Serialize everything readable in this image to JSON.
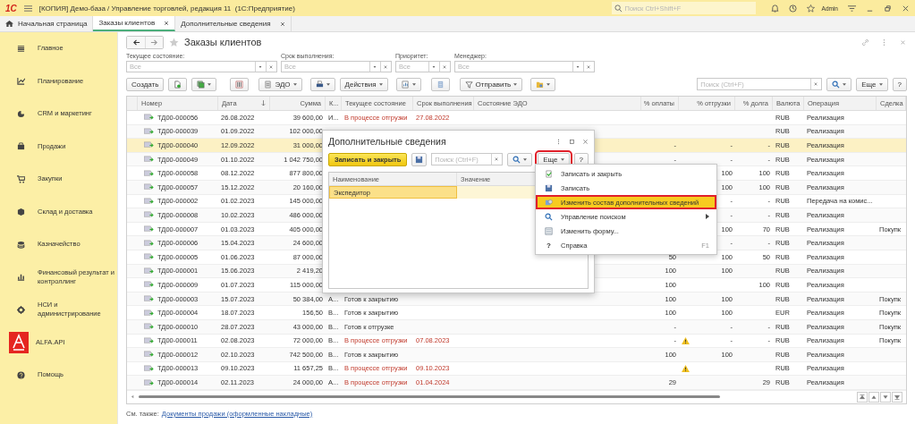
{
  "window": {
    "logo": "1С",
    "title": "[КОПИЯ] Демо-база / Управление торговлей, редакция 11  (1С:Предприятие)",
    "search_placeholder": "Поиск Ctrl+Shift+F",
    "user": "Admin"
  },
  "tabs": [
    {
      "label": "Начальная страница",
      "selected": false,
      "closable": false
    },
    {
      "label": "Заказы клиентов",
      "selected": true,
      "closable": true
    },
    {
      "label": "Дополнительные сведения",
      "selected": false,
      "closable": true
    }
  ],
  "sidebar": {
    "items": [
      {
        "label": "Главное",
        "kind": "list"
      },
      {
        "label": "Планирование",
        "kind": "chart"
      },
      {
        "label": "CRM и маркетинг",
        "kind": "pie"
      },
      {
        "label": "Продажи",
        "kind": "bag"
      },
      {
        "label": "Закупки",
        "kind": "cart"
      },
      {
        "label": "Склад и доставка",
        "kind": "box"
      },
      {
        "label": "Казначейство",
        "kind": "coins"
      },
      {
        "label": "Финансовый результат и контроллинг",
        "kind": "graph"
      },
      {
        "label": "НСИ и администрирование",
        "kind": "gear"
      },
      {
        "label": "ALFA.API",
        "kind": "logo"
      },
      {
        "label": "Помощь",
        "kind": "help"
      }
    ]
  },
  "form": {
    "title": "Заказы клиентов",
    "filters": [
      {
        "label": "Текущее состояние:",
        "placeholder": "Все"
      },
      {
        "label": "Срок выполнения:",
        "placeholder": "Все"
      },
      {
        "label": "Приоритет:",
        "placeholder": "Все"
      },
      {
        "label": "Менеджер:",
        "placeholder": "Все"
      }
    ]
  },
  "toolbar": {
    "items": [
      {
        "kind": "text",
        "label": "Создать",
        "dropdown": false
      },
      {
        "kind": "icon",
        "dropdown": false
      },
      {
        "kind": "icon",
        "dropdown": true
      },
      {
        "kind": "icon",
        "dropdown": false
      },
      {
        "kind": "text",
        "label": "ЭДО",
        "dropdown": true
      },
      {
        "kind": "icon",
        "dropdown": true
      },
      {
        "kind": "text",
        "label": "Действия",
        "dropdown": true
      },
      {
        "kind": "icon",
        "dropdown": true
      },
      {
        "kind": "icon",
        "dropdown": false
      },
      {
        "kind": "text",
        "label": "Отправить",
        "dropdown": true
      },
      {
        "kind": "icon",
        "dropdown": true
      }
    ],
    "search_placeholder": "Поиск (Ctrl+F)",
    "more": "Еще",
    "help": "?"
  },
  "table": {
    "columns": [
      "Номер",
      "Дата",
      "Сумма",
      "К...",
      "Текущее состояние",
      "Срок выполнения",
      "Состояние ЭДО",
      "% оплаты",
      "% отгрузки",
      "% долга",
      "Валюта",
      "Операция",
      "Сделка"
    ],
    "rows": [
      {
        "number": "ТД00-000056",
        "date": "26.08.2022",
        "sum": "39 600,00",
        "k": "И...",
        "state": "В процессе отгрузки",
        "overdue": true,
        "due": "27.08.2022",
        "currency": "RUB",
        "operation": "Реализация",
        "selected": false,
        "ship_warning": false
      },
      {
        "number": "ТД00-000039",
        "date": "01.09.2022",
        "sum": "102 000,00",
        "currency": "RUB",
        "operation": "Реализация",
        "selected": false,
        "ship_warning": false
      },
      {
        "number": "ТД00-000040",
        "date": "12.09.2022",
        "sum": "31 000,00",
        "pay": "-",
        "ship": "-",
        "debt": "-",
        "currency": "RUB",
        "operation": "Реализация",
        "selected": true,
        "ship_warning": false
      },
      {
        "number": "ТД00-000049",
        "date": "01.10.2022",
        "sum": "1 042 750,00",
        "pay": "-",
        "ship": "-",
        "debt": "-",
        "currency": "RUB",
        "operation": "Реализация",
        "selected": false,
        "ship_warning": false
      },
      {
        "number": "ТД00-000058",
        "date": "08.12.2022",
        "sum": "877 800,00",
        "ship": "100",
        "debt": "100",
        "currency": "RUB",
        "operation": "Реализация",
        "selected": false,
        "ship_warning": false
      },
      {
        "number": "ТД00-000057",
        "date": "15.12.2022",
        "sum": "20 160,00",
        "ship": "100",
        "debt": "100",
        "currency": "RUB",
        "operation": "Реализация",
        "selected": false,
        "ship_warning": false
      },
      {
        "number": "ТД00-000002",
        "date": "01.02.2023",
        "sum": "145 000,00",
        "ship": "-",
        "debt": "-",
        "currency": "RUB",
        "operation": "Передача на комис...",
        "selected": false,
        "ship_warning": false
      },
      {
        "number": "ТД00-000008",
        "date": "10.02.2023",
        "sum": "486 000,00",
        "ship": "-",
        "debt": "-",
        "currency": "RUB",
        "operation": "Реализация",
        "selected": false,
        "ship_warning": false
      },
      {
        "number": "ТД00-000007",
        "date": "01.03.2023",
        "sum": "405 000,00",
        "ship": "100",
        "debt": "70",
        "currency": "RUB",
        "operation": "Реализация",
        "deal": "Покупк",
        "selected": false,
        "ship_warning": false
      },
      {
        "number": "ТД00-000006",
        "date": "15.04.2023",
        "sum": "24 600,00",
        "ship": "-",
        "debt": "-",
        "currency": "RUB",
        "operation": "Реализация",
        "selected": false,
        "ship_warning": false
      },
      {
        "number": "ТД00-000005",
        "date": "01.06.2023",
        "sum": "87 000,00",
        "pay": "50",
        "ship": "100",
        "debt": "50",
        "currency": "RUB",
        "operation": "Реализация",
        "selected": false,
        "ship_warning": false
      },
      {
        "number": "ТД00-000001",
        "date": "15.06.2023",
        "sum": "2 419,20",
        "pay": "100",
        "ship": "100",
        "currency": "RUB",
        "operation": "Реализация",
        "selected": false,
        "ship_warning": false
      },
      {
        "number": "ТД00-000009",
        "date": "01.07.2023",
        "sum": "115 000,00",
        "pay": "100",
        "debt": "100",
        "currency": "RUB",
        "operation": "Реализация",
        "selected": false,
        "ship_warning": false
      },
      {
        "number": "ТД00-000003",
        "date": "15.07.2023",
        "sum": "50 384,00",
        "k": "А...",
        "state": "Готов к закрытию",
        "overdue": false,
        "pay": "100",
        "ship": "100",
        "currency": "RUB",
        "operation": "Реализация",
        "deal": "Покупк",
        "selected": false,
        "ship_warning": false
      },
      {
        "number": "ТД00-000004",
        "date": "18.07.2023",
        "sum": "156,50",
        "k": "В...",
        "state": "Готов к закрытию",
        "overdue": false,
        "pay": "100",
        "ship": "100",
        "currency": "EUR",
        "operation": "Реализация",
        "deal": "Покупк",
        "selected": false,
        "ship_warning": false
      },
      {
        "number": "ТД00-000010",
        "date": "28.07.2023",
        "sum": "43 000,00",
        "k": "В...",
        "state": "Готов к отгрузке",
        "overdue": false,
        "pay": "-",
        "ship": "-",
        "debt": "-",
        "currency": "RUB",
        "operation": "Реализация",
        "deal": "Покупк",
        "selected": false,
        "ship_warning": false
      },
      {
        "number": "ТД00-000011",
        "date": "02.08.2023",
        "sum": "72 000,00",
        "k": "В...",
        "state": "В процессе отгрузки",
        "overdue": true,
        "due": "07.08.2023",
        "pay": "-",
        "ship": "-",
        "debt": "-",
        "currency": "RUB",
        "operation": "Реализация",
        "deal": "Покупк",
        "selected": false,
        "ship_warning": true
      },
      {
        "number": "ТД00-000012",
        "date": "02.10.2023",
        "sum": "742 500,00",
        "k": "В...",
        "state": "Готов к закрытию",
        "overdue": false,
        "pay": "100",
        "ship": "100",
        "currency": "RUB",
        "operation": "Реализация",
        "selected": false,
        "ship_warning": false
      },
      {
        "number": "ТД00-000013",
        "date": "09.10.2023",
        "sum": "11 657,25",
        "k": "В...",
        "state": "В процессе отгрузки",
        "overdue": true,
        "due": "09.10.2023",
        "currency": "RUB",
        "operation": "Реализация",
        "selected": false,
        "ship_warning": true
      },
      {
        "number": "ТД00-000014",
        "date": "02.11.2023",
        "sum": "24 000,00",
        "k": "А...",
        "state": "В процессе отгрузки",
        "overdue": true,
        "due": "01.04.2024",
        "pay": "29",
        "debt": "29",
        "currency": "RUB",
        "operation": "Реализация",
        "selected": false,
        "ship_warning": false
      }
    ]
  },
  "footer": {
    "prefix": "См. также:",
    "link": "Документы продажи (оформленные накладные)"
  },
  "dialog": {
    "title": "Дополнительные сведения",
    "save_close": "Записать и закрыть",
    "search_placeholder": "Поиск (Ctrl+F)",
    "more": {
      "label": "Еще",
      "highlighted": true
    },
    "help": "?",
    "columns": [
      "Наименование",
      "Значение"
    ],
    "rows": [
      {
        "name": "Экспедитор",
        "selected": true
      }
    ]
  },
  "menu": {
    "items": [
      {
        "label": "Записать и закрыть",
        "submenu": false,
        "highlighted": false
      },
      {
        "label": "Записать",
        "submenu": false,
        "highlighted": false
      },
      {
        "label": "Изменить состав дополнительных сведений",
        "submenu": false,
        "highlighted": true
      },
      {
        "label": "Управление поиском",
        "submenu": true,
        "highlighted": false
      },
      {
        "label": "Изменить форму...",
        "submenu": false,
        "highlighted": false
      },
      {
        "label": "Справка",
        "glyph": "?",
        "shortcut": "F1",
        "submenu": false,
        "highlighted": false
      }
    ]
  }
}
